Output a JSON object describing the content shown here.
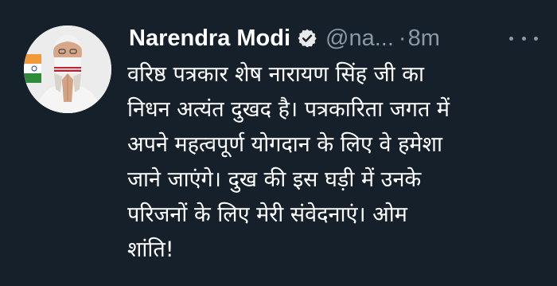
{
  "tweet": {
    "author_name": "Narendra Modi",
    "handle": "@na...",
    "separator": "·",
    "timestamp": "8m",
    "lines": [
      "वरिष्ठ पत्रकार शेष नारायण सिंह जी का",
      "निधन अत्यंत दुखद है। पत्रकारिता जगत में",
      "अपने महत्वपूर्ण योगदान के लिए वे हमेशा",
      "जाने जाएंगे। दुख की इस घड़ी में उनके",
      "परिजनों के लिए मेरी संवेदनाएं। ओम",
      "शांति!"
    ]
  },
  "icons": {
    "verified": "verified-badge-icon",
    "more": "more-options-icon"
  },
  "colors": {
    "background": "#15202b",
    "text": "#ffffff",
    "secondary_text": "#8b98a5"
  }
}
